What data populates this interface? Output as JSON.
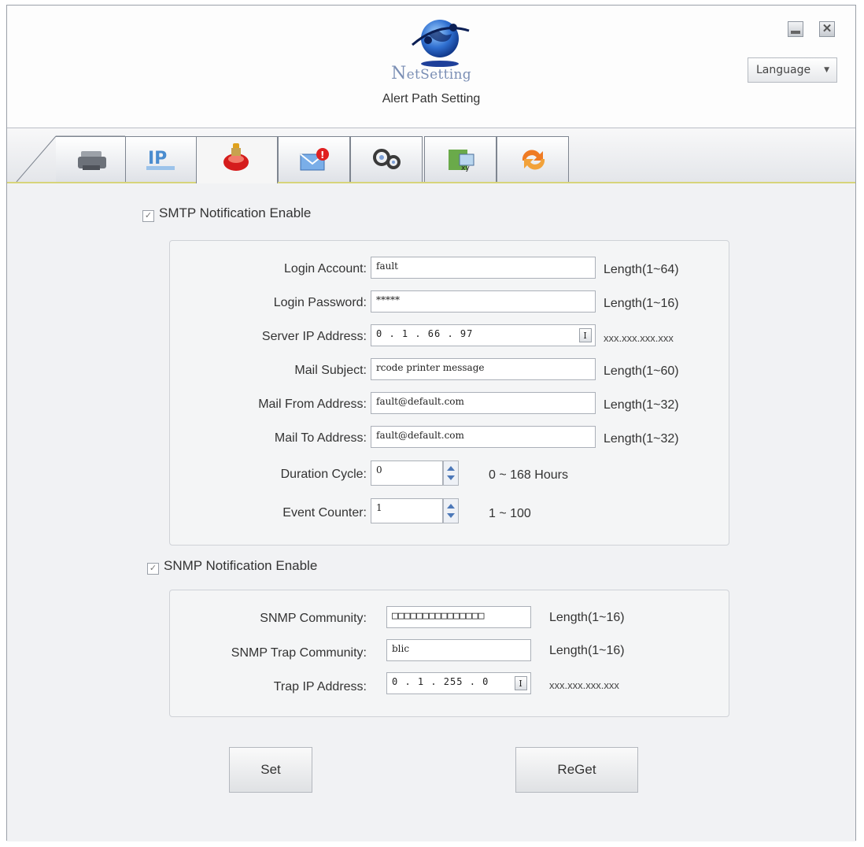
{
  "app": {
    "brand_first": "N",
    "brand_rest": "etSetting",
    "subtitle": "Alert Path Setting",
    "language_label": "Language"
  },
  "tabs": [
    {
      "icon": "printer-icon"
    },
    {
      "icon": "ip-network-icon"
    },
    {
      "icon": "alert-bell-icon"
    },
    {
      "icon": "mail-alert-icon"
    },
    {
      "icon": "gears-icon"
    },
    {
      "icon": "xy-settings-icon"
    },
    {
      "icon": "refresh-icon"
    }
  ],
  "smtp": {
    "enable_label": "SMTP Notification Enable",
    "enabled": true,
    "fields": {
      "login_account": {
        "label": "Login Account:",
        "value": "fault",
        "hint": "Length(1~64)"
      },
      "login_password": {
        "label": "Login Password:",
        "value": "*****",
        "hint": "Length(1~16)"
      },
      "server_ip": {
        "label": "Server IP Address:",
        "value": "0 . 1 . 66 . 97",
        "hint": "xxx.xxx.xxx.xxx"
      },
      "mail_subject": {
        "label": "Mail Subject:",
        "value": "rcode printer message",
        "hint": "Length(1~60)"
      },
      "mail_from": {
        "label": "Mail From Address:",
        "value": "fault@default.com",
        "hint": "Length(1~32)"
      },
      "mail_to": {
        "label": "Mail To Address:",
        "value": "fault@default.com",
        "hint": "Length(1~32)"
      },
      "duration_cycle": {
        "label": "Duration Cycle:",
        "value": "0",
        "hint": "0 ~ 168 Hours"
      },
      "event_counter": {
        "label": "Event Counter:",
        "value": "1",
        "hint": "1 ~ 100"
      }
    }
  },
  "snmp": {
    "enable_label": "SNMP Notification Enable",
    "enabled": true,
    "fields": {
      "community": {
        "label": "SNMP Community:",
        "value": "□□□□□□□□□□□□□□□",
        "hint": "Length(1~16)"
      },
      "trap_community": {
        "label": "SNMP Trap Community:",
        "value": "blic",
        "hint": "Length(1~16)"
      },
      "trap_ip": {
        "label": "Trap IP Address:",
        "value": "0 . 1 . 255 . 0",
        "hint": "xxx.xxx.xxx.xxx"
      }
    }
  },
  "buttons": {
    "set": "Set",
    "reget": "ReGet"
  },
  "ip_button_glyph": "I",
  "checkmark_glyph": "✓",
  "close_glyph": "✕",
  "caret_glyph": "▼"
}
